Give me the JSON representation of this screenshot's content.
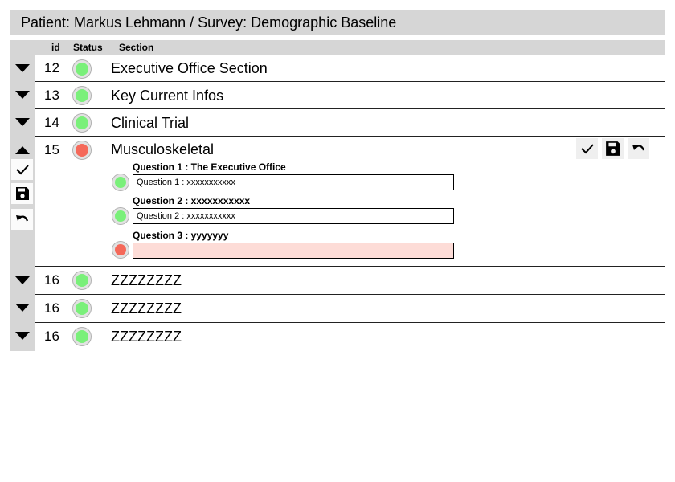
{
  "title": "Patient: Markus Lehmann / Survey: Demographic Baseline",
  "columns": {
    "id": "id",
    "status": "Status",
    "section": "Section"
  },
  "colors": {
    "ok": "#7af07a",
    "error": "#f5695a",
    "bar": "#d6d6d6",
    "error_field": "#fddcd7"
  },
  "rows": [
    {
      "id": "12",
      "title": "Executive Office Section",
      "status": "ok",
      "toggle": "expand"
    },
    {
      "id": "13",
      "title": "Key Current Infos",
      "status": "ok",
      "toggle": "expand"
    },
    {
      "id": "14",
      "title": "Clinical Trial",
      "status": "ok",
      "toggle": "expand"
    },
    {
      "id": "15",
      "title": "Musculoskeletal",
      "status": "error",
      "toggle": "collapse"
    },
    {
      "id": "16",
      "title": "ZZZZZZZZ",
      "status": "ok",
      "toggle": "expand"
    },
    {
      "id": "16",
      "title": "ZZZZZZZZ",
      "status": "ok",
      "toggle": "expand"
    },
    {
      "id": "16",
      "title": "ZZZZZZZZ",
      "status": "ok",
      "toggle": "expand"
    }
  ],
  "expanded": {
    "questions": [
      {
        "label": "Question 1 : The Executive Office",
        "value": "Question 1 : xxxxxxxxxxx",
        "status": "ok"
      },
      {
        "label": "Question 2 : xxxxxxxxxxx",
        "value": "Question 2 : xxxxxxxxxxx",
        "status": "ok"
      },
      {
        "label": "Question 3 : yyyyyyy",
        "value": "",
        "status": "error"
      }
    ],
    "actions": {
      "confirm_icon": "check-icon",
      "save_icon": "floppy-disk-icon",
      "undo_icon": "undo-icon"
    }
  }
}
